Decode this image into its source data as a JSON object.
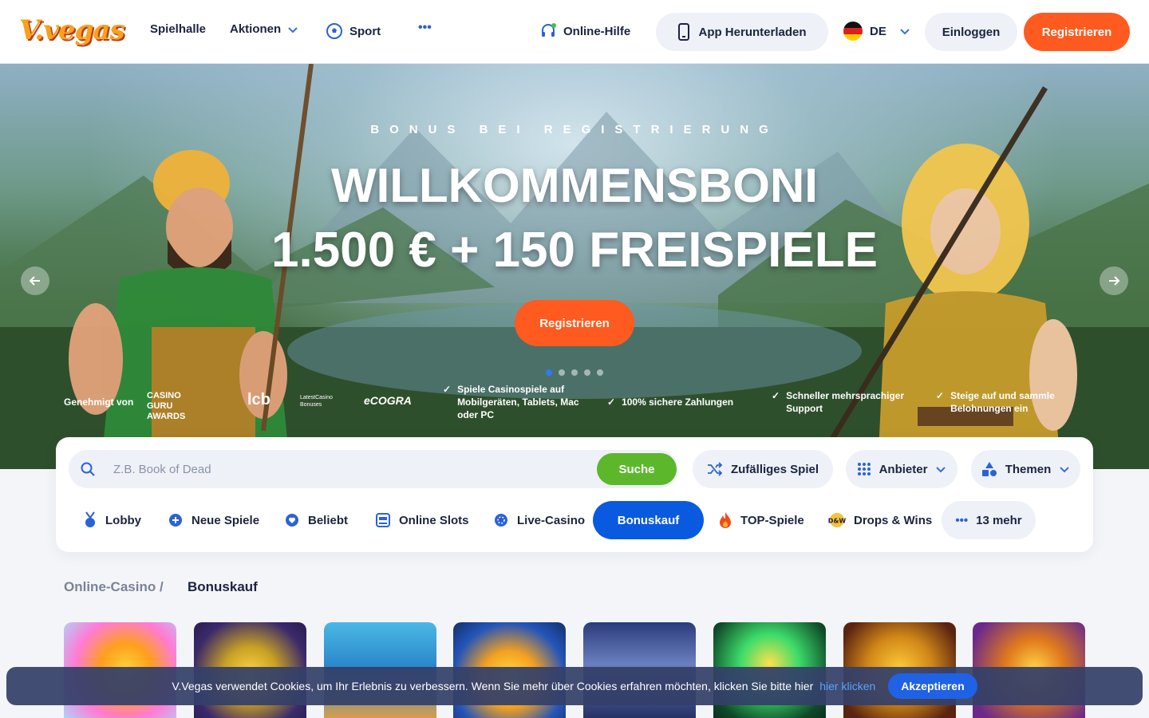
{
  "header": {
    "logo_text": "V.vegas",
    "nav": [
      "Spielhalle",
      "Aktionen",
      "Sport"
    ],
    "more_label": "•••",
    "help_label": "Online-Hilfe",
    "app_label": "App Herunterladen",
    "lang_label": "DE",
    "login_label": "Einloggen",
    "register_label": "Registrieren"
  },
  "hero": {
    "subtitle": "BONUS BEI REGISTRIERUNG",
    "title": "WILLKOMMENSBONI",
    "title2": "1.500 € + 150 FREISPIELE",
    "cta": "Registrieren",
    "slides": 5,
    "active_slide": 1,
    "approved_label": "Genehmigt von",
    "partners": [
      "CASINO GURU AWARDS",
      "lcb",
      "LatestCasino Bonuses",
      "eCOGRA"
    ],
    "features": [
      "Spiele Casinospiele auf Mobilgeräten, Tablets, Mac oder PC",
      "100% sichere Zahlungen",
      "Schneller mehrsprachiger Support",
      "Steige auf und sammle Belohnungen ein"
    ]
  },
  "search": {
    "placeholder": "Z.B. Book of Dead",
    "button": "Suche",
    "random_label": "Zufälliges Spiel",
    "provider_label": "Anbieter",
    "themes_label": "Themen"
  },
  "categories": [
    "Lobby",
    "Neue Spiele",
    "Beliebt",
    "Online Slots",
    "Live-Casino",
    "Bonuskauf",
    "TOP-Spiele",
    "Drops & Wins",
    "13 mehr"
  ],
  "breadcrumb": {
    "root": "Online-Casino /",
    "current": "Bonuskauf"
  },
  "cookie": {
    "text": "V.Vegas verwendet Cookies, um Ihr Erlebnis zu verbessern. Wenn Sie mehr über Cookies erfahren möchten, klicken Sie bitte hier",
    "link": "hier klicken",
    "accept": "Akzeptieren"
  },
  "colors": {
    "accent": "#ff5a1f",
    "primary": "#0a5ae0",
    "search_button": "#5cb82a"
  }
}
